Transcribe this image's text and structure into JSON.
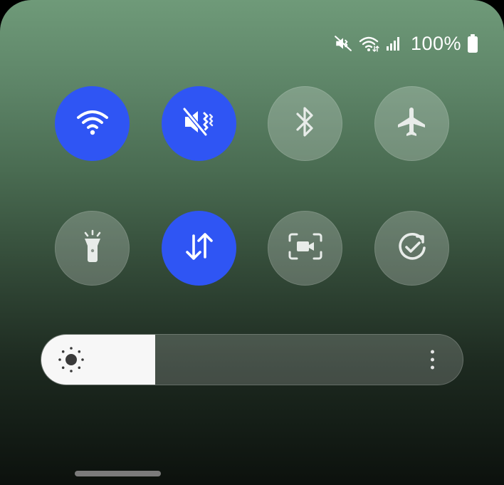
{
  "status_bar": {
    "icons": [
      "mute-icon",
      "wifi-icon",
      "signal-icon"
    ],
    "battery_text": "100%",
    "battery_icon": "battery-full-icon"
  },
  "quick_tiles": [
    {
      "name": "wifi",
      "icon": "wifi-icon",
      "state": "on"
    },
    {
      "name": "mute",
      "icon": "sound-mute-icon",
      "state": "on"
    },
    {
      "name": "bluetooth",
      "icon": "bluetooth-icon",
      "state": "off"
    },
    {
      "name": "airplane-mode",
      "icon": "airplane-icon",
      "state": "off"
    },
    {
      "name": "flashlight",
      "icon": "flashlight-icon",
      "state": "off"
    },
    {
      "name": "mobile-data",
      "icon": "data-transfer-icon",
      "state": "on"
    },
    {
      "name": "screen-recorder",
      "icon": "screen-record-icon",
      "state": "off"
    },
    {
      "name": "auto-rotate",
      "icon": "rotate-check-icon",
      "state": "off"
    }
  ],
  "brightness": {
    "level": 0.27,
    "icon": "sun-icon",
    "more_icon": "more-vertical-icon"
  },
  "colors": {
    "accent": "#2f55f4",
    "tile_off": "rgba(255,255,255,0.22)",
    "icon_on": "#ffffff",
    "icon_off": "#e8ece9"
  }
}
